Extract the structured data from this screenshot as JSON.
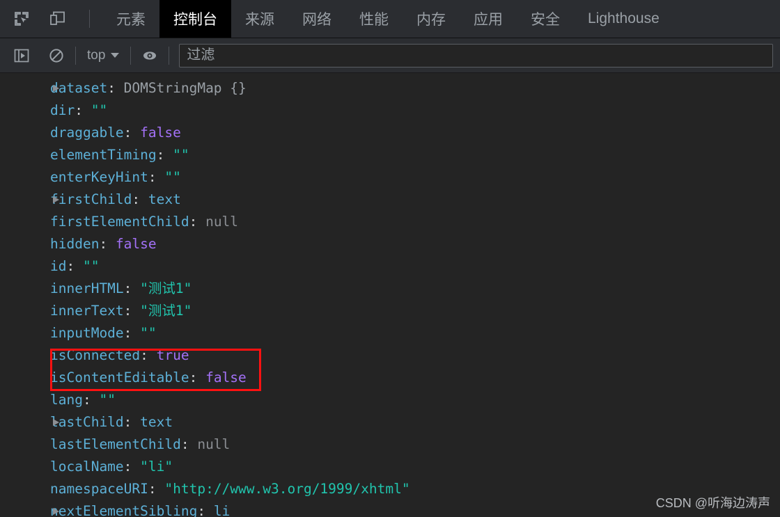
{
  "devtools": {
    "left_icons": [
      {
        "name": "inspect-element-icon",
        "title": "检查元素"
      },
      {
        "name": "device-toolbar-icon",
        "title": "设备工具栏"
      }
    ],
    "tabs": [
      {
        "label": "元素",
        "active": false
      },
      {
        "label": "控制台",
        "active": true
      },
      {
        "label": "来源",
        "active": false
      },
      {
        "label": "网络",
        "active": false
      },
      {
        "label": "性能",
        "active": false
      },
      {
        "label": "内存",
        "active": false
      },
      {
        "label": "应用",
        "active": false
      },
      {
        "label": "安全",
        "active": false
      },
      {
        "label": "Lighthouse",
        "active": false
      }
    ]
  },
  "console_toolbar": {
    "sidebar_toggle_icon": "console-sidebar-icon",
    "clear_console_icon": "clear-console-icon",
    "context_label": "top",
    "eye_icon": "live-expression-eye-icon",
    "filter": {
      "value": "",
      "placeholder": "过滤"
    }
  },
  "console_output": {
    "lines": [
      {
        "expandable": true,
        "key": "dataset",
        "value": "DOMStringMap {}",
        "value_type": "object"
      },
      {
        "expandable": false,
        "key": "dir",
        "value": "\"\"",
        "value_type": "string"
      },
      {
        "expandable": false,
        "key": "draggable",
        "value": "false",
        "value_type": "keyword"
      },
      {
        "expandable": false,
        "key": "elementTiming",
        "value": "\"\"",
        "value_type": "string"
      },
      {
        "expandable": false,
        "key": "enterKeyHint",
        "value": "\"\"",
        "value_type": "string"
      },
      {
        "expandable": true,
        "key": "firstChild",
        "value": "text",
        "value_type": "node"
      },
      {
        "expandable": false,
        "key": "firstElementChild",
        "value": "null",
        "value_type": "null"
      },
      {
        "expandable": false,
        "key": "hidden",
        "value": "false",
        "value_type": "keyword"
      },
      {
        "expandable": false,
        "key": "id",
        "value": "\"\"",
        "value_type": "string"
      },
      {
        "expandable": false,
        "key": "innerHTML",
        "value": "\"测试1\"",
        "value_type": "string",
        "highlighted": true
      },
      {
        "expandable": false,
        "key": "innerText",
        "value": "\"测试1\"",
        "value_type": "string",
        "highlighted": true
      },
      {
        "expandable": false,
        "key": "inputMode",
        "value": "\"\"",
        "value_type": "string"
      },
      {
        "expandable": false,
        "key": "isConnected",
        "value": "true",
        "value_type": "keyword"
      },
      {
        "expandable": false,
        "key": "isContentEditable",
        "value": "false",
        "value_type": "keyword"
      },
      {
        "expandable": false,
        "key": "lang",
        "value": "\"\"",
        "value_type": "string"
      },
      {
        "expandable": true,
        "key": "lastChild",
        "value": "text",
        "value_type": "node"
      },
      {
        "expandable": false,
        "key": "lastElementChild",
        "value": "null",
        "value_type": "null"
      },
      {
        "expandable": false,
        "key": "localName",
        "value": "\"li\"",
        "value_type": "string"
      },
      {
        "expandable": false,
        "key": "namespaceURI",
        "value": "\"http://www.w3.org/1999/xhtml\"",
        "value_type": "string"
      },
      {
        "expandable": true,
        "key": "nextElementSibling",
        "value": "li",
        "value_type": "node"
      }
    ]
  },
  "watermark": {
    "text": "CSDN @听海边涛声"
  },
  "colors": {
    "background": "#242424",
    "toolbar": "#2b2d31",
    "active_tab_bg": "#000000",
    "key": "#5db0d7",
    "string": "#21c4ad",
    "keyword": "#a371f7",
    "null": "#8b8e93",
    "highlight_border": "#ff1111"
  }
}
